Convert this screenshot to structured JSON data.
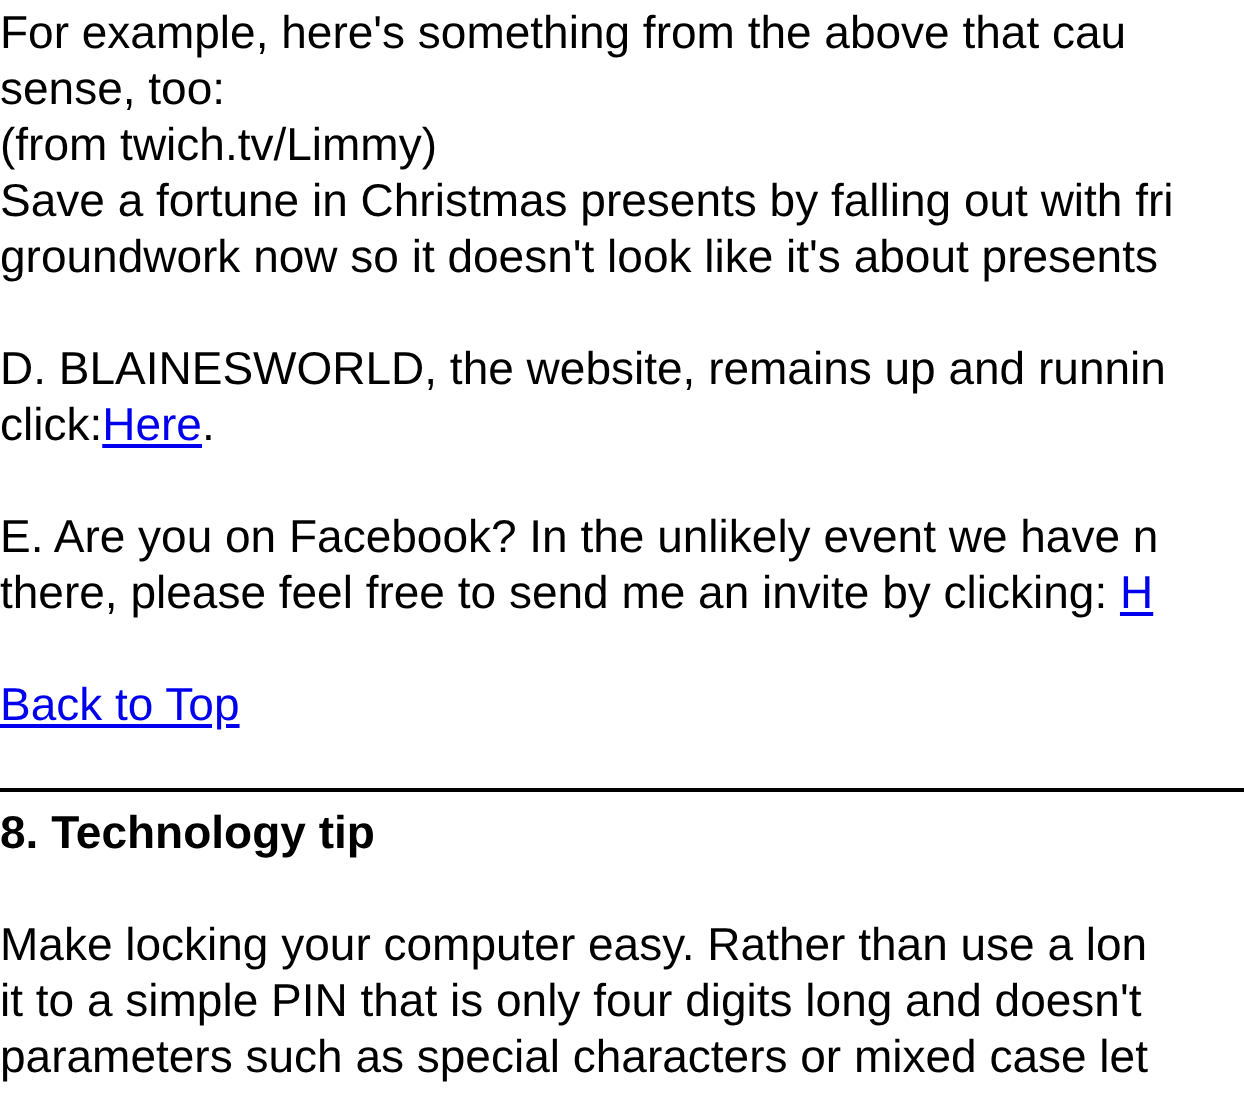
{
  "intro": {
    "lines": [
      "For example, here's something from the above that cau",
      "sense, too:"
    ]
  },
  "quote": {
    "source": "(from twich.tv/Limmy)",
    "lines": [
      "Save a fortune in Christmas presents by falling out with fri",
      "groundwork now so it doesn't look like it's about presents"
    ]
  },
  "items": [
    {
      "lines": [
        {
          "text": "D. BLAINESWORLD, the website, remains up and runnin"
        },
        {
          "text": "click:",
          "link": "Here",
          "after": "."
        }
      ]
    },
    {
      "lines": [
        {
          "text": "E. Are you on Facebook? In the unlikely event we have n"
        },
        {
          "text": "there, please feel free to send me an invite by clicking: ",
          "link": "H"
        }
      ]
    }
  ],
  "back_to_top": "Back to Top",
  "section": {
    "heading": "8. Technology tip",
    "lines": [
      "Make locking your computer easy. Rather than use a lon",
      "it to a simple PIN that is only four digits long and doesn't",
      "parameters such as special characters or mixed case let"
    ]
  }
}
